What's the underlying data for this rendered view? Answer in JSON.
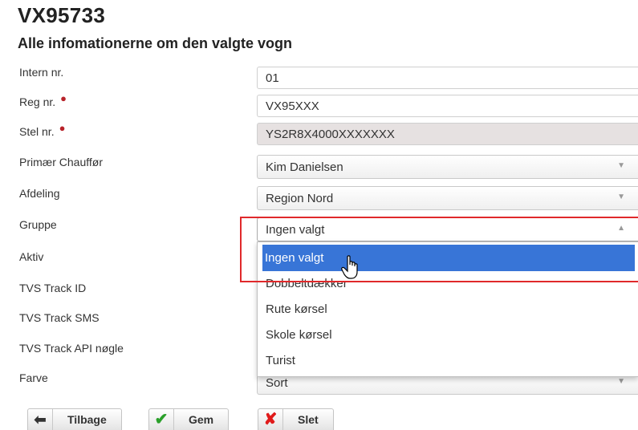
{
  "vehicle": {
    "title": "VX95733",
    "subtitle": "Alle infomationerne om den valgte vogn"
  },
  "fields": {
    "intern_nr": {
      "label": "Intern nr.",
      "value": "01"
    },
    "reg_nr": {
      "label": "Reg nr.",
      "value": "VX95XXX",
      "required_marker": "●"
    },
    "stel_nr": {
      "label": "Stel nr.",
      "value": "YS2R8X4000XXXXXXX",
      "required_marker": "●"
    },
    "primaer_chauffor": {
      "label": "Primær Chauffør",
      "value": "Kim Danielsen"
    },
    "afdeling": {
      "label": "Afdeling",
      "value": "Region Nord"
    },
    "gruppe": {
      "label": "Gruppe",
      "value": "Ingen valgt"
    },
    "aktiv": {
      "label": "Aktiv"
    },
    "tvs_track_id": {
      "label": "TVS Track ID"
    },
    "tvs_track_sms": {
      "label": "TVS Track SMS"
    },
    "tvs_track_api": {
      "label": "TVS Track API nøgle"
    },
    "farve": {
      "label": "Farve",
      "value": "Sort"
    }
  },
  "gruppe_dropdown": {
    "options": [
      "Ingen valgt",
      "Dobbeltdækker",
      "Rute kørsel",
      "Skole kørsel",
      "Turist"
    ],
    "selected": "Ingen valgt"
  },
  "buttons": {
    "back": "Tilbage",
    "save": "Gem",
    "delete": "Slet"
  },
  "colors": {
    "selected_option": "#3875d7",
    "highlight_box": "#e0292b",
    "required": "#b8232a",
    "save_check": "#2aa02a",
    "delete_x": "#e01b1b"
  },
  "icons": {
    "back": "arrow-left-icon",
    "save": "checkmark-icon",
    "delete": "x-icon",
    "caret_down": "caret-down-icon",
    "caret_up": "caret-up-icon"
  }
}
